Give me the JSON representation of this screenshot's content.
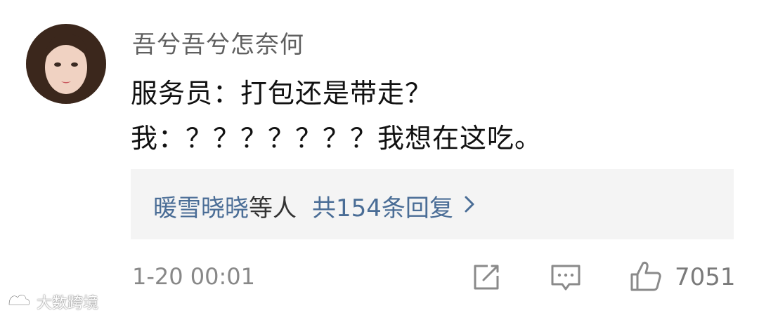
{
  "comment": {
    "author": "吾兮吾兮怎奈何",
    "content_lines": [
      "服务员：打包还是带走？",
      "我：？？？？？？？我想在这吃。"
    ],
    "replies": {
      "user": "暖雪晓晓",
      "others_label": "等人",
      "count_label": "共154条回复",
      "chevron_icon": "chevron-right-icon"
    },
    "footer": {
      "time": "1-20 00:01",
      "edit_icon": "edit-icon",
      "reply_icon": "comment-icon",
      "like_icon": "thumbs-up-icon",
      "likes": "7051"
    }
  },
  "watermark": {
    "text": "大数跨境"
  },
  "colors": {
    "link_blue": "#4a6d96",
    "text_primary": "#111111",
    "text_secondary": "#888888",
    "reply_box_bg": "#f4f4f4"
  }
}
